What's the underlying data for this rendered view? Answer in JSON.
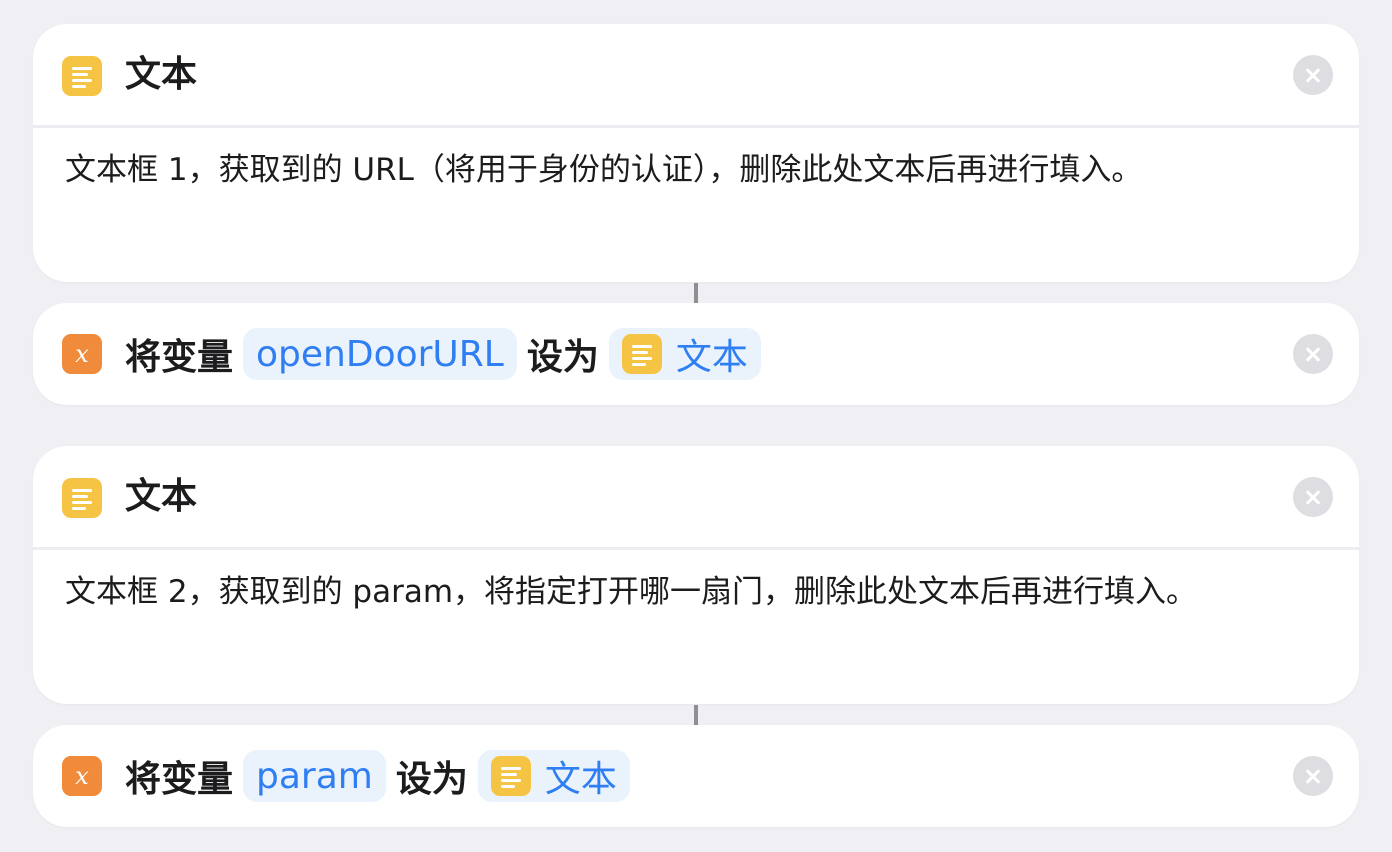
{
  "actions": [
    {
      "type": "text",
      "title": "文本",
      "content": "文本框 1，获取到的 URL（将用于身份的认证），删除此处文本后再进行填入。"
    },
    {
      "type": "set-variable",
      "verb": "将变量",
      "variable": "openDoorURL",
      "connector": "设为",
      "value": "文本"
    },
    {
      "type": "text",
      "title": "文本",
      "content": "文本框 2，获取到的 param，将指定打开哪一扇门，删除此处文本后再进行填入。"
    },
    {
      "type": "set-variable",
      "verb": "将变量",
      "variable": "param",
      "connector": "设为",
      "value": "文本"
    }
  ],
  "icons": {
    "text_action": "text-lines-icon",
    "variable_action": "variable-x-icon",
    "remove": "close-circle-icon"
  },
  "colors": {
    "background": "#efeff4",
    "text_icon": "#f6c445",
    "variable_icon": "#ef8b3b",
    "token_text": "#2f7ef2",
    "token_bg": "#eaf2fc"
  }
}
